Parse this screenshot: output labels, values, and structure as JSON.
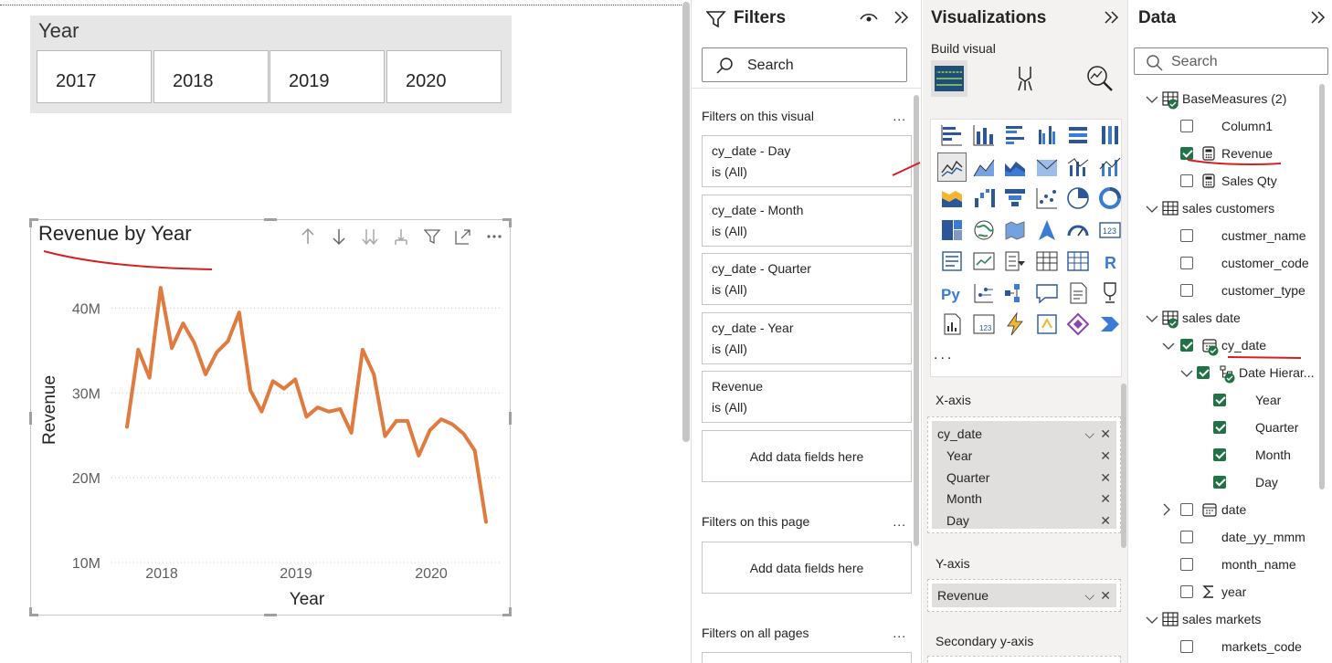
{
  "slicer": {
    "title": "Year",
    "items": [
      "2017",
      "2018",
      "2019",
      "2020"
    ]
  },
  "visual": {
    "title": "Revenue by Year",
    "header_icons": [
      "arrow-up-icon",
      "arrow-down-icon",
      "double-arrow-down-icon",
      "expand-hierarchy-icon",
      "filter-icon",
      "focus-mode-icon",
      "more-options-icon"
    ]
  },
  "chart_data": {
    "type": "line",
    "xlabel": "Year",
    "ylabel": "Revenue",
    "x_ticks": [
      "2018",
      "2019",
      "2020"
    ],
    "y_ticks": [
      "10M",
      "20M",
      "30M",
      "40M"
    ],
    "ylim": [
      10,
      45
    ],
    "grid": true,
    "color": "#E07A3F",
    "series": [
      {
        "name": "Revenue",
        "values": [
          26.0,
          35.1,
          31.8,
          42.4,
          35.3,
          38.2,
          35.9,
          32.2,
          34.8,
          36.1,
          39.5,
          30.3,
          27.8,
          31.4,
          30.5,
          31.6,
          27.2,
          28.3,
          27.8,
          28.1,
          25.3,
          35.1,
          32.2,
          24.9,
          26.7,
          26.7,
          22.6,
          25.6,
          26.9,
          26.3,
          25.2,
          23.2,
          14.8
        ]
      }
    ]
  },
  "filters": {
    "title": "Filters",
    "search_placeholder": "Search",
    "on_visual_label": "Filters on this visual",
    "cards": [
      {
        "name": "cy_date - Day",
        "value": "is (All)"
      },
      {
        "name": "cy_date - Month",
        "value": "is (All)"
      },
      {
        "name": "cy_date - Quarter",
        "value": "is (All)"
      },
      {
        "name": "cy_date - Year",
        "value": "is (All)"
      },
      {
        "name": "Revenue",
        "value": "is (All)"
      }
    ],
    "add_fields": "Add data fields here",
    "on_page_label": "Filters on this page",
    "add_fields_page": "Add data fields here",
    "all_pages_label": "Filters on all pages",
    "more": "..."
  },
  "visualizations": {
    "title": "Visualizations",
    "build_label": "Build visual",
    "more": "...",
    "x_axis": {
      "label": "X-axis",
      "field": "cy_date",
      "levels": [
        "Year",
        "Quarter",
        "Month",
        "Day"
      ]
    },
    "y_axis": {
      "label": "Y-axis",
      "field": "Revenue"
    },
    "secondary_y_axis": {
      "label": "Secondary y-axis"
    },
    "glyph_r": "R",
    "glyph_py": "Py",
    "glyph_123": "123"
  },
  "data": {
    "title": "Data",
    "search_placeholder": "Search",
    "tree": [
      {
        "label": "BaseMeasures (2)"
      },
      {
        "label": "Column1"
      },
      {
        "label": "Revenue"
      },
      {
        "label": "Sales Qty"
      },
      {
        "label": "sales customers"
      },
      {
        "label": "custmer_name"
      },
      {
        "label": "customer_code"
      },
      {
        "label": "customer_type"
      },
      {
        "label": "sales date"
      },
      {
        "label": "cy_date"
      },
      {
        "label": "Date Hierar..."
      },
      {
        "label": "Year"
      },
      {
        "label": "Quarter"
      },
      {
        "label": "Month"
      },
      {
        "label": "Day"
      },
      {
        "label": "date"
      },
      {
        "label": "date_yy_mmm"
      },
      {
        "label": "month_name"
      },
      {
        "label": "year"
      },
      {
        "label": "sales markets"
      },
      {
        "label": "markets_code"
      }
    ]
  }
}
